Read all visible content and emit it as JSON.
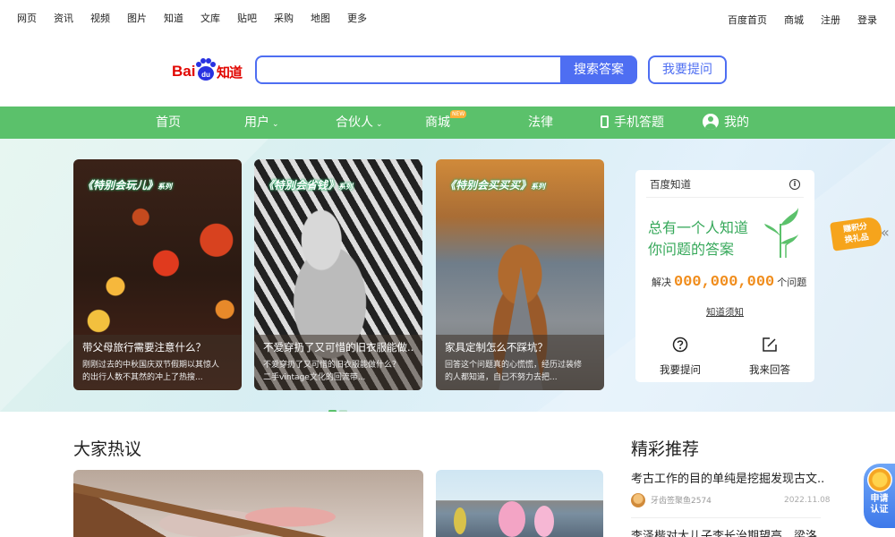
{
  "topnav": {
    "left": [
      "网页",
      "资讯",
      "视频",
      "图片",
      "知道",
      "文库",
      "贴吧",
      "采购",
      "地图",
      "更多"
    ],
    "right": [
      "百度首页",
      "商城",
      "注册",
      "登录"
    ]
  },
  "logo": {
    "bai": "Bai",
    "du": "du",
    "zhidao": "知道"
  },
  "search": {
    "placeholder": "",
    "button": "搜索答案",
    "ask_button": "我要提问"
  },
  "greenbar": {
    "home": "首页",
    "users": "用户",
    "partners": "合伙人",
    "mall": "商城",
    "mall_badge": "NEW",
    "law": "法律",
    "mobile": "手机答题",
    "mine": "我的"
  },
  "carousel": [
    {
      "series_a": "《特别会玩儿》",
      "series_b": "系列",
      "question": "带父母旅行需要注意什么？",
      "desc1": "刚刚过去的中秋国庆双节假期以其惊人",
      "desc2": "的出行人数不其然的冲上了热搜..."
    },
    {
      "series_a": "《特别会省钱》",
      "series_b": "系列",
      "question": "不爱穿扔了又可惜的旧衣服能做...",
      "desc1": "不爱穿扔了又可惜的旧衣服能做什么？",
      "desc2": "二手vintage文化的回流带..."
    },
    {
      "series_a": "《特别会买买买》",
      "series_b": "系列",
      "question": "家具定制怎么不踩坑？",
      "desc1": "回答这个问题真的心慌慌，经历过装修",
      "desc2": "的人都知道，自己不努力去把..."
    }
  ],
  "infobox": {
    "header": "百度知道",
    "slogan1": "总有一个人知道",
    "slogan2": "你问题的答案",
    "solved_prefix": "解决",
    "solved_count": "000,000,000",
    "solved_suffix": "个问题",
    "notice": "知道须知",
    "ask": "我要提问",
    "answer": "我来回答"
  },
  "points_badge": {
    "line1": "赚积分",
    "line2": "换礼品"
  },
  "hot": {
    "title": "大家热议"
  },
  "recommend": {
    "title": "精彩推荐",
    "items": [
      {
        "question": "考古工作的目的单纯是挖掘发现古文...",
        "user": "牙齿签聚鱼2574",
        "date": "2022.11.08"
      },
      {
        "question": "李泽楷对大儿子李长治期望高，梁洛..."
      }
    ]
  },
  "apply_badge": {
    "line1": "申请",
    "line2": "认证"
  },
  "colors": {
    "brand_red": "#e10601",
    "accent_blue": "#4e6ef2",
    "nav_green": "#5bc16b",
    "counter_orange": "#f08c1b"
  }
}
